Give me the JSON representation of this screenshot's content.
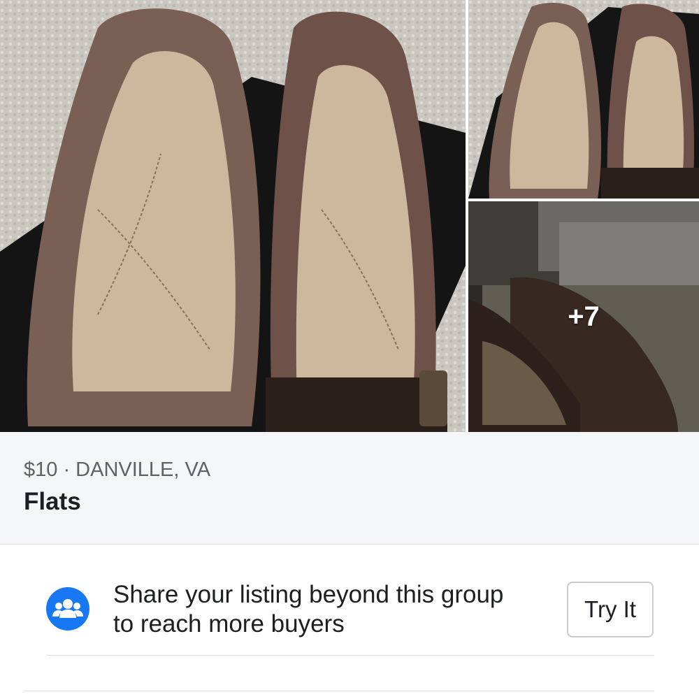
{
  "photos": {
    "more_count_label": "+7",
    "main_alt": "Brown leather flat shoes on a shoe box",
    "top_alt": "Flat shoes on shoe box, alternate view",
    "bottom_alt": "Flat shoes on a bed"
  },
  "listing": {
    "price_location": "$10 · DANVILLE, VA",
    "title": "Flats"
  },
  "share_promo": {
    "icon": "group-icon",
    "text": "Share your listing beyond this group to reach more buyers",
    "button_label": "Try It"
  },
  "colors": {
    "accent": "#1877f2",
    "panel_bg": "#f5f6f7",
    "text_primary": "#1c1e21",
    "text_secondary": "#5d6168"
  }
}
